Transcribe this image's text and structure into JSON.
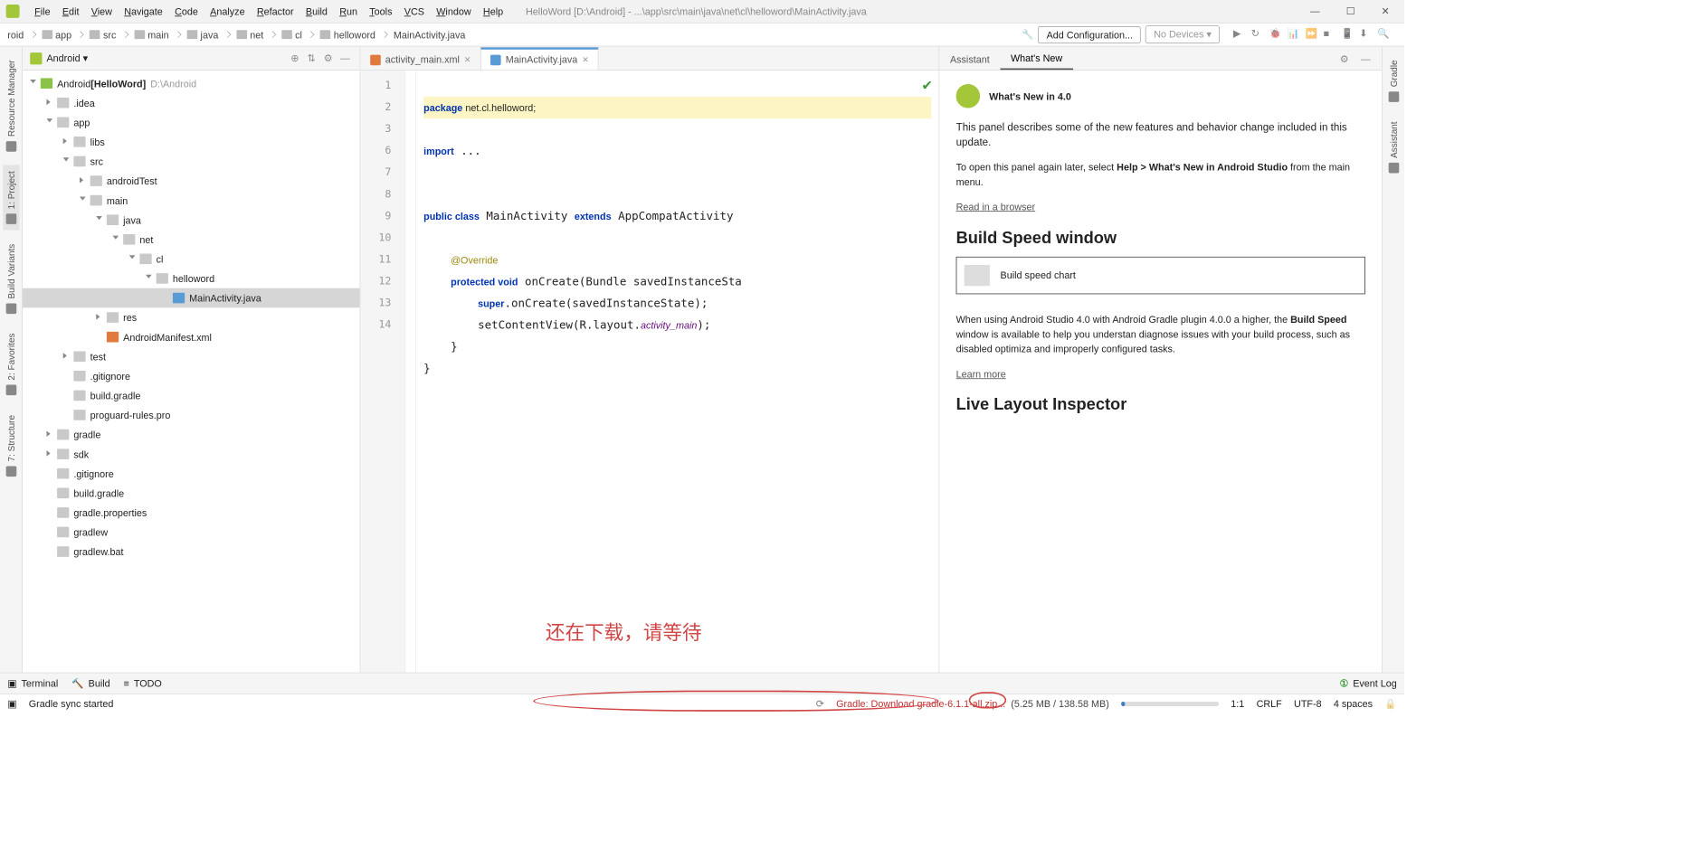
{
  "menu": [
    "File",
    "Edit",
    "View",
    "Navigate",
    "Code",
    "Analyze",
    "Refactor",
    "Build",
    "Run",
    "Tools",
    "VCS",
    "Window",
    "Help"
  ],
  "windowTitle": "HelloWord [D:\\Android] - ...\\app\\src\\main\\java\\net\\cl\\helloword\\MainActivity.java",
  "breadcrumbs": [
    "roid",
    "app",
    "src",
    "main",
    "java",
    "net",
    "cl",
    "helloword",
    "MainActivity.java"
  ],
  "toolbar": {
    "addConfig": "Add Configuration...",
    "noDevices": "No Devices ▾"
  },
  "leftTabs": [
    "Resource Manager",
    "1: Project",
    "Build Variants",
    "2: Favorites",
    "7: Structure"
  ],
  "rightTabs": [
    "Gradle",
    "Assistant"
  ],
  "projectHead": {
    "label": "Android ▾"
  },
  "tree": [
    {
      "d": 0,
      "open": true,
      "icon": "j",
      "label": "Android",
      "bold": "[HelloWord]",
      "dim": "D:\\Android"
    },
    {
      "d": 1,
      "arr": true,
      "label": ".idea"
    },
    {
      "d": 1,
      "open": true,
      "arr": true,
      "label": "app"
    },
    {
      "d": 2,
      "arr": true,
      "label": "libs"
    },
    {
      "d": 2,
      "open": true,
      "arr": true,
      "label": "src"
    },
    {
      "d": 3,
      "arr": true,
      "label": "androidTest"
    },
    {
      "d": 3,
      "open": true,
      "arr": true,
      "label": "main"
    },
    {
      "d": 4,
      "open": true,
      "arr": true,
      "label": "java"
    },
    {
      "d": 5,
      "open": true,
      "arr": true,
      "label": "net"
    },
    {
      "d": 6,
      "open": true,
      "arr": true,
      "label": "cl"
    },
    {
      "d": 7,
      "open": true,
      "arr": true,
      "label": "helloword"
    },
    {
      "d": 8,
      "noarr": true,
      "sel": true,
      "icon": "f",
      "label": "MainActivity.java"
    },
    {
      "d": 4,
      "arr": true,
      "label": "res"
    },
    {
      "d": 4,
      "noarr": true,
      "icon": "x",
      "label": "AndroidManifest.xml"
    },
    {
      "d": 2,
      "arr": true,
      "label": "test"
    },
    {
      "d": 2,
      "noarr": true,
      "label": ".gitignore"
    },
    {
      "d": 2,
      "noarr": true,
      "label": "build.gradle"
    },
    {
      "d": 2,
      "noarr": true,
      "label": "proguard-rules.pro"
    },
    {
      "d": 1,
      "arr": true,
      "label": "gradle"
    },
    {
      "d": 1,
      "arr": true,
      "label": "sdk"
    },
    {
      "d": 1,
      "noarr": true,
      "label": ".gitignore"
    },
    {
      "d": 1,
      "noarr": true,
      "label": "build.gradle"
    },
    {
      "d": 1,
      "noarr": true,
      "label": "gradle.properties"
    },
    {
      "d": 1,
      "noarr": true,
      "label": "gradlew"
    },
    {
      "d": 1,
      "noarr": true,
      "label": "gradlew.bat"
    }
  ],
  "editorTabs": [
    {
      "label": "activity_main.xml",
      "icon": "x"
    },
    {
      "label": "MainActivity.java",
      "icon": "j",
      "active": true
    }
  ],
  "gutter": [
    "1",
    "2",
    "3",
    "6",
    "7",
    "8",
    "9",
    "10",
    "11",
    "12",
    "13",
    "14"
  ],
  "code": {
    "l1": "package net.cl.helloword;",
    "l3": "import ...",
    "l7": "public class MainActivity extends AppCompatActivity",
    "l9": "    @Override",
    "l10": "    protected void onCreate(Bundle savedInstanceSta",
    "l11": "        super.onCreate(savedInstanceState);",
    "l12": "        setContentView(R.layout.activity_main);",
    "l13": "    }",
    "l14": "}"
  },
  "overlayNote": "还在下载，请等待",
  "rightPanel": {
    "tabs": [
      "Assistant",
      "What's New"
    ],
    "title": "What's New in 4.0",
    "p1": "This panel describes some of the new features and behavior change included in this update.",
    "p2a": "To open this panel again later, select ",
    "p2b": "Help > What's New in Android Studio",
    "p2c": " from the main menu.",
    "link1": "Read in a browser",
    "h2a": "Build Speed window",
    "img1": "Build speed chart",
    "p3a": "When using Android Studio 4.0 with Android Gradle plugin 4.0.0 a higher, the ",
    "p3b": "Build Speed",
    "p3c": " window is available to help you understan diagnose issues with your build process, such as disabled optimiza and improperly configured tasks.",
    "link2": "Learn more",
    "h2b": "Live Layout Inspector"
  },
  "bottomTabs": [
    "Terminal",
    "Build",
    "TODO"
  ],
  "eventLog": "Event Log",
  "status": {
    "left": "Gradle sync started",
    "dl": "Gradle: Download gradle-6.1.1-all.zip...",
    "size": "(5.25 MB / 138.58 MB)",
    "pos": "1:1",
    "eol": "CRLF",
    "enc": "UTF-8",
    "indent": "4 spaces"
  }
}
